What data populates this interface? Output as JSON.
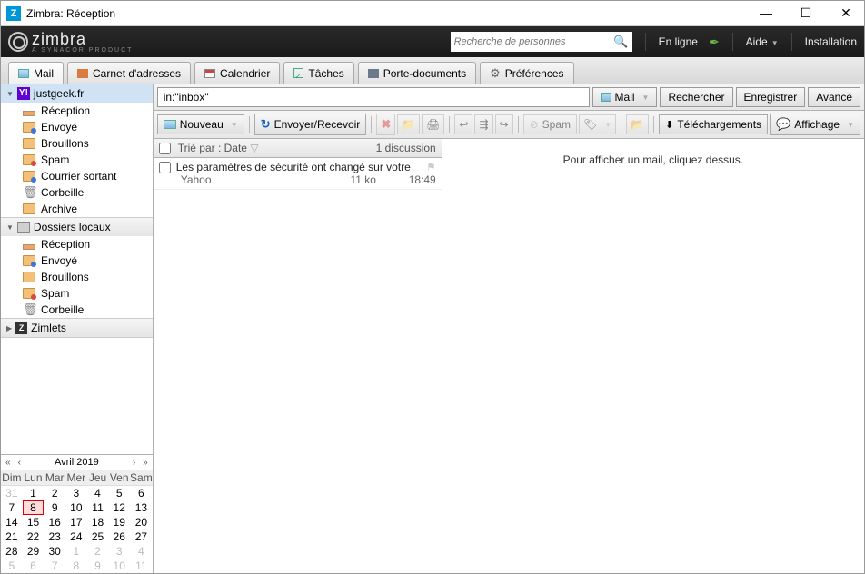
{
  "window": {
    "title": "Zimbra: Réception"
  },
  "header": {
    "brand": "zimbra",
    "brand_sub": "A SYNACOR PRODUCT",
    "search_placeholder": "Recherche de personnes",
    "status": "En ligne",
    "help": "Aide",
    "install": "Installation"
  },
  "tabs": {
    "mail": "Mail",
    "contacts": "Carnet d'adresses",
    "calendar": "Calendrier",
    "tasks": "Tâches",
    "briefcase": "Porte-documents",
    "prefs": "Préférences"
  },
  "sidebar": {
    "account": "justgeek.fr",
    "items": [
      {
        "label": "Réception"
      },
      {
        "label": "Envoyé"
      },
      {
        "label": "Brouillons"
      },
      {
        "label": "Spam"
      },
      {
        "label": "Courrier sortant"
      },
      {
        "label": "Corbeille"
      },
      {
        "label": "Archive"
      }
    ],
    "local_header": "Dossiers locaux",
    "local": [
      {
        "label": "Réception"
      },
      {
        "label": "Envoyé"
      },
      {
        "label": "Brouillons"
      },
      {
        "label": "Spam"
      },
      {
        "label": "Corbeille"
      }
    ],
    "zimlets": "Zimlets"
  },
  "calendar": {
    "title": "Avril 2019",
    "dayheaders": [
      "Dim",
      "Lun",
      "Mar",
      "Mer",
      "Jeu",
      "Ven",
      "Sam"
    ],
    "weeks": [
      [
        {
          "d": "31",
          "o": true
        },
        {
          "d": "1"
        },
        {
          "d": "2"
        },
        {
          "d": "3"
        },
        {
          "d": "4"
        },
        {
          "d": "5"
        },
        {
          "d": "6"
        }
      ],
      [
        {
          "d": "7"
        },
        {
          "d": "8",
          "today": true
        },
        {
          "d": "9"
        },
        {
          "d": "10"
        },
        {
          "d": "11"
        },
        {
          "d": "12"
        },
        {
          "d": "13"
        }
      ],
      [
        {
          "d": "14"
        },
        {
          "d": "15"
        },
        {
          "d": "16"
        },
        {
          "d": "17"
        },
        {
          "d": "18"
        },
        {
          "d": "19"
        },
        {
          "d": "20"
        }
      ],
      [
        {
          "d": "21"
        },
        {
          "d": "22"
        },
        {
          "d": "23"
        },
        {
          "d": "24"
        },
        {
          "d": "25"
        },
        {
          "d": "26"
        },
        {
          "d": "27"
        }
      ],
      [
        {
          "d": "28"
        },
        {
          "d": "29"
        },
        {
          "d": "30"
        },
        {
          "d": "1",
          "o": true
        },
        {
          "d": "2",
          "o": true
        },
        {
          "d": "3",
          "o": true
        },
        {
          "d": "4",
          "o": true
        }
      ],
      [
        {
          "d": "5",
          "o": true
        },
        {
          "d": "6",
          "o": true
        },
        {
          "d": "7",
          "o": true
        },
        {
          "d": "8",
          "o": true
        },
        {
          "d": "9",
          "o": true
        },
        {
          "d": "10",
          "o": true
        },
        {
          "d": "11",
          "o": true
        }
      ]
    ]
  },
  "searchbar": {
    "query": "in:\"inbox\"",
    "scope": "Mail",
    "search": "Rechercher",
    "save": "Enregistrer",
    "advanced": "Avancé"
  },
  "toolbar": {
    "new": "Nouveau",
    "sendreceive": "Envoyer/Recevoir",
    "spam": "Spam",
    "downloads": "Téléchargements",
    "display": "Affichage"
  },
  "listhead": {
    "sort": "Trié par : Date",
    "count": "1 discussion"
  },
  "messages": [
    {
      "subject": "Les paramètres de sécurité ont changé sur votre",
      "from": "Yahoo",
      "size": "11 ko",
      "time": "18:49"
    }
  ],
  "preview": {
    "placeholder": "Pour afficher un mail, cliquez dessus."
  }
}
